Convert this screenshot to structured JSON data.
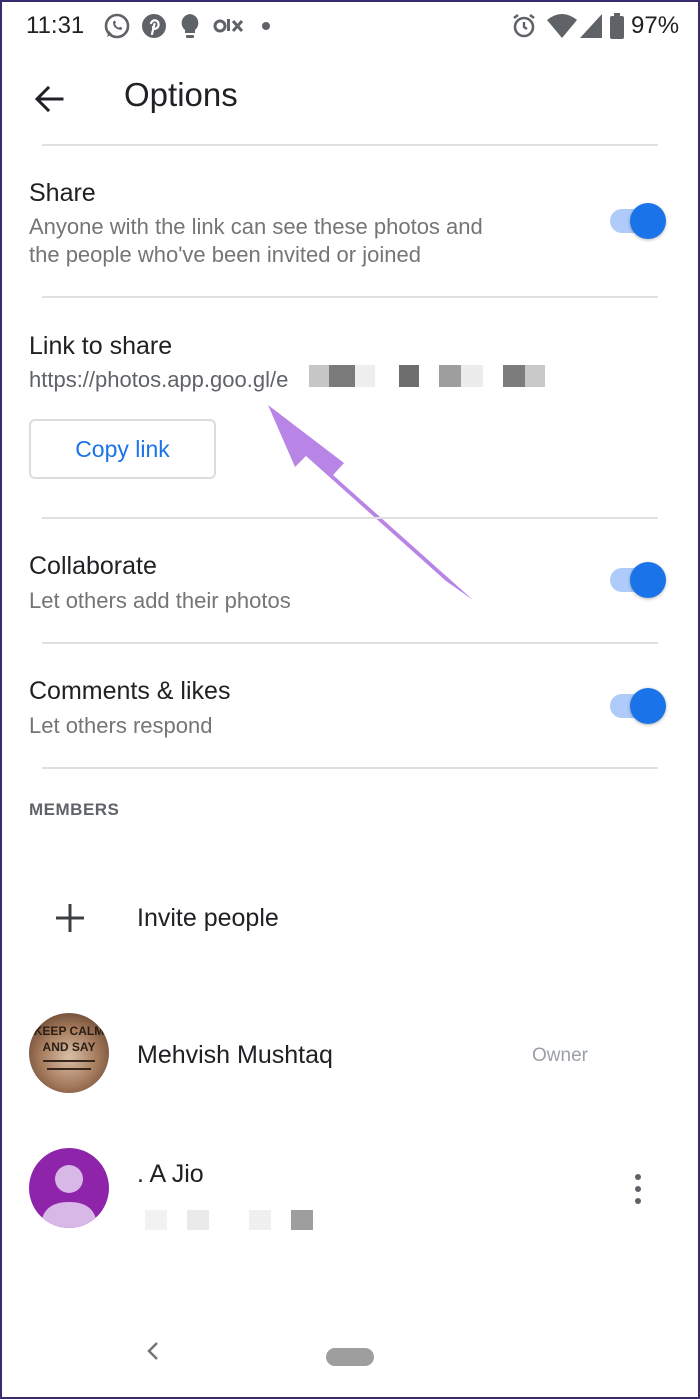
{
  "status_bar": {
    "time": "11:31",
    "battery": "97%",
    "notification_icons": [
      "whatsapp-icon",
      "pinterest-icon",
      "lightbulb-icon",
      "olx-icon",
      "dot-icon"
    ],
    "system_icons": [
      "alarm-icon",
      "wifi-icon",
      "signal-icon",
      "battery-icon"
    ]
  },
  "toolbar": {
    "title": "Options",
    "back_icon": "arrow-back-icon"
  },
  "share": {
    "title": "Share",
    "subtitle_line1": "Anyone with the link can see these photos and",
    "subtitle_line2": "the people who've been invited or joined",
    "enabled": true
  },
  "link": {
    "title": "Link to share",
    "url": "https://photos.app.goo.gl/e",
    "copy_label": "Copy link"
  },
  "collaborate": {
    "title": "Collaborate",
    "subtitle": "Let others add their photos",
    "enabled": true
  },
  "comments": {
    "title": "Comments & likes",
    "subtitle": "Let others respond",
    "enabled": true
  },
  "members": {
    "section_label": "MEMBERS",
    "invite_label": "Invite people",
    "owner": {
      "name": "Mehvish Mushtaq",
      "role": "Owner",
      "avatar_text_line1": "KEEP CALM",
      "avatar_text_line2": "AND SAY"
    },
    "other": {
      "name": ". A Jio"
    }
  },
  "colors": {
    "accent": "#1a73e8",
    "toggle_track": "#aecbfa",
    "arrow": "#b884e6",
    "avatar_purple": "#8e24aa"
  }
}
